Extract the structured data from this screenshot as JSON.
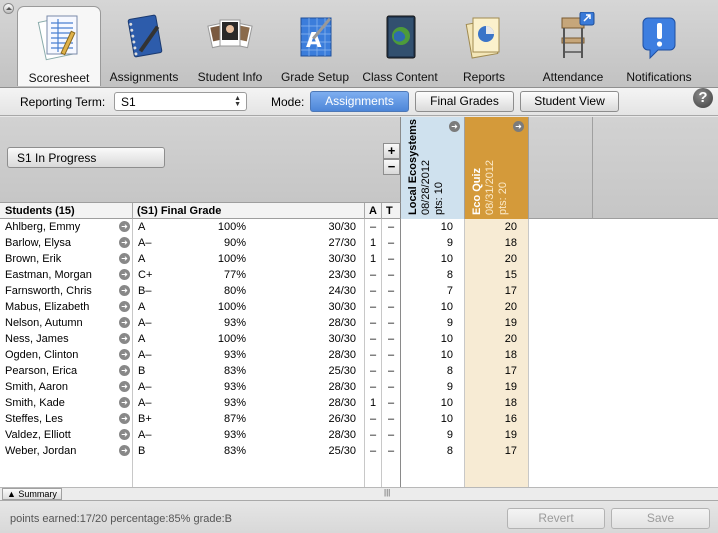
{
  "toolbar": {
    "items": [
      {
        "label": "Scoresheet",
        "icon": "scoresheet-icon",
        "active": true
      },
      {
        "label": "Assignments",
        "icon": "notebook-icon"
      },
      {
        "label": "Student Info",
        "icon": "student-photos-icon"
      },
      {
        "label": "Grade Setup",
        "icon": "grade-setup-icon"
      },
      {
        "label": "Class Content",
        "icon": "class-content-icon"
      },
      {
        "label": "Reports",
        "icon": "reports-icon"
      },
      {
        "label": "Attendance",
        "icon": "attendance-chair-icon"
      },
      {
        "label": "Notifications",
        "icon": "notifications-icon"
      }
    ]
  },
  "filters": {
    "term_label": "Reporting Term:",
    "term_value": "S1",
    "mode_label": "Mode:",
    "modes": [
      {
        "label": "Assignments",
        "selected": true
      },
      {
        "label": "Final Grades",
        "selected": false
      },
      {
        "label": "Student View",
        "selected": false
      }
    ],
    "help": "?"
  },
  "left": {
    "progress_button": "S1 In Progress",
    "plus": "+",
    "minus": "−",
    "headers": {
      "students": "Students (15)",
      "final_grade": "(S1) Final Grade",
      "a": "A",
      "t": "T"
    },
    "summary": "Summary",
    "grip": "|||"
  },
  "students": [
    {
      "name": "Ahlberg, Emmy",
      "grade": "A",
      "percent": "100%",
      "points": "30/30",
      "a": "–",
      "t": "–"
    },
    {
      "name": "Barlow, Elysa",
      "grade": "A–",
      "percent": "90%",
      "points": "27/30",
      "a": "1",
      "t": "–"
    },
    {
      "name": "Brown, Erik",
      "grade": "A",
      "percent": "100%",
      "points": "30/30",
      "a": "1",
      "t": "–"
    },
    {
      "name": "Eastman, Morgan",
      "grade": "C+",
      "percent": "77%",
      "points": "23/30",
      "a": "–",
      "t": "–"
    },
    {
      "name": "Farnsworth, Chris",
      "grade": "B–",
      "percent": "80%",
      "points": "24/30",
      "a": "–",
      "t": "–"
    },
    {
      "name": "Mabus, Elizabeth",
      "grade": "A",
      "percent": "100%",
      "points": "30/30",
      "a": "–",
      "t": "–"
    },
    {
      "name": "Nelson, Autumn",
      "grade": "A–",
      "percent": "93%",
      "points": "28/30",
      "a": "–",
      "t": "–"
    },
    {
      "name": "Ness, James",
      "grade": "A",
      "percent": "100%",
      "points": "30/30",
      "a": "–",
      "t": "–"
    },
    {
      "name": "Ogden, Clinton",
      "grade": "A–",
      "percent": "93%",
      "points": "28/30",
      "a": "–",
      "t": "–"
    },
    {
      "name": "Pearson, Erica",
      "grade": "B",
      "percent": "83%",
      "points": "25/30",
      "a": "–",
      "t": "–"
    },
    {
      "name": "Smith, Aaron",
      "grade": "A–",
      "percent": "93%",
      "points": "28/30",
      "a": "–",
      "t": "–"
    },
    {
      "name": "Smith, Kade",
      "grade": "A–",
      "percent": "93%",
      "points": "28/30",
      "a": "1",
      "t": "–"
    },
    {
      "name": "Steffes, Les",
      "grade": "B+",
      "percent": "87%",
      "points": "26/30",
      "a": "–",
      "t": "–"
    },
    {
      "name": "Valdez, Elliott",
      "grade": "A–",
      "percent": "93%",
      "points": "28/30",
      "a": "–",
      "t": "–"
    },
    {
      "name": "Weber, Jordan",
      "grade": "B",
      "percent": "83%",
      "points": "25/30",
      "a": "–",
      "t": "–"
    }
  ],
  "assignments": [
    {
      "title": "Local Ecosystems",
      "date": "08/28/2012",
      "pts": "pts: 10",
      "color": "#cfe1ee",
      "scores": [
        "10",
        "9",
        "10",
        "8",
        "7",
        "10",
        "9",
        "10",
        "10",
        "8",
        "9",
        "10",
        "10",
        "9",
        "8"
      ]
    },
    {
      "title": "Eco Quiz",
      "date": "08/31/2012",
      "pts": "pts: 20",
      "color": "#d49a3a",
      "scores": [
        "20",
        "18",
        "20",
        "15",
        "17",
        "20",
        "19",
        "20",
        "18",
        "17",
        "19",
        "18",
        "16",
        "19",
        "17"
      ]
    }
  ],
  "status": {
    "text": "points earned:17/20  percentage:85%  grade:B"
  },
  "buttons": {
    "revert": "Revert",
    "save": "Save"
  }
}
